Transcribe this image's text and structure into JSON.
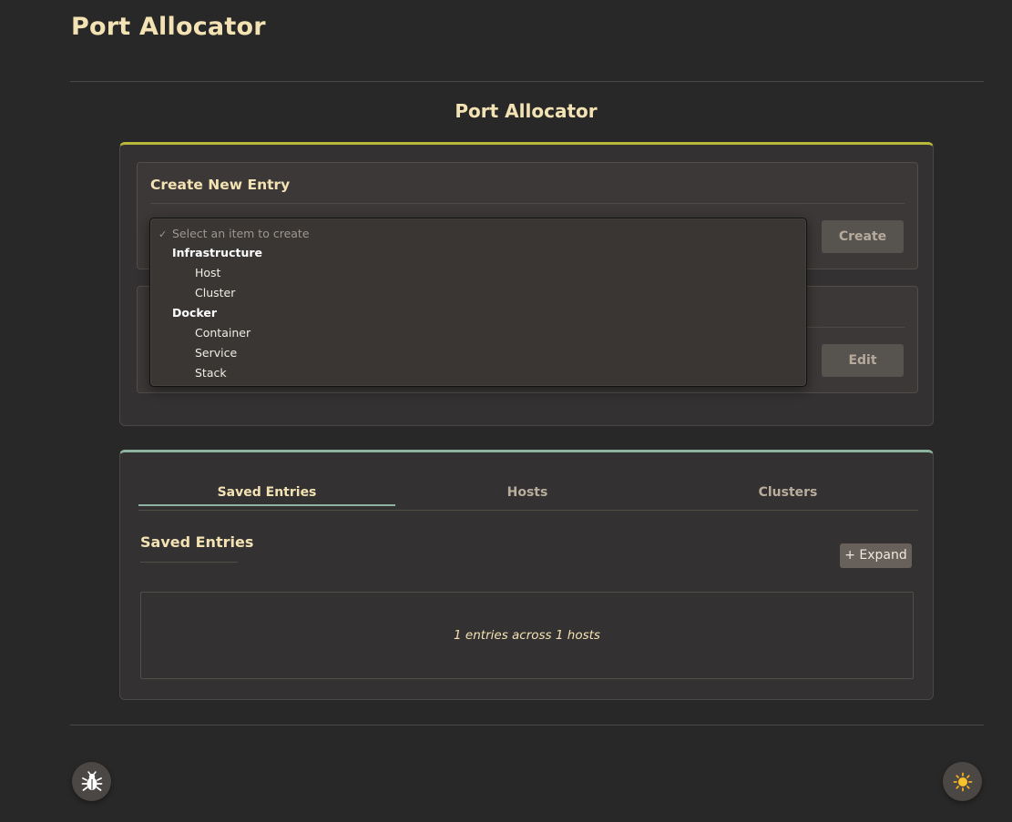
{
  "app": {
    "title": "Port Allocator"
  },
  "page": {
    "title": "Port Allocator"
  },
  "create_panel": {
    "title": "Create New Entry",
    "button": "Create",
    "dropdown": {
      "placeholder": "Select an item to create",
      "groups": [
        {
          "label": "Infrastructure",
          "items": [
            "Host",
            "Cluster"
          ]
        },
        {
          "label": "Docker",
          "items": [
            "Container",
            "Service",
            "Stack"
          ]
        }
      ]
    }
  },
  "edit_panel": {
    "button": "Edit"
  },
  "tabs": {
    "items": [
      "Saved Entries",
      "Hosts",
      "Clusters"
    ],
    "active": "Saved Entries"
  },
  "saved_entries": {
    "title": "Saved Entries",
    "expand_button": "+ Expand",
    "summary": "1 entries across 1 hosts"
  },
  "footer": {
    "bug_icon": "bug-icon",
    "theme_icon": "sun-icon"
  },
  "colors": {
    "background": "#282828",
    "accent_yellow": "#b8b83a",
    "accent_green": "#8fb3a1",
    "title_text": "#f3e2b3"
  }
}
